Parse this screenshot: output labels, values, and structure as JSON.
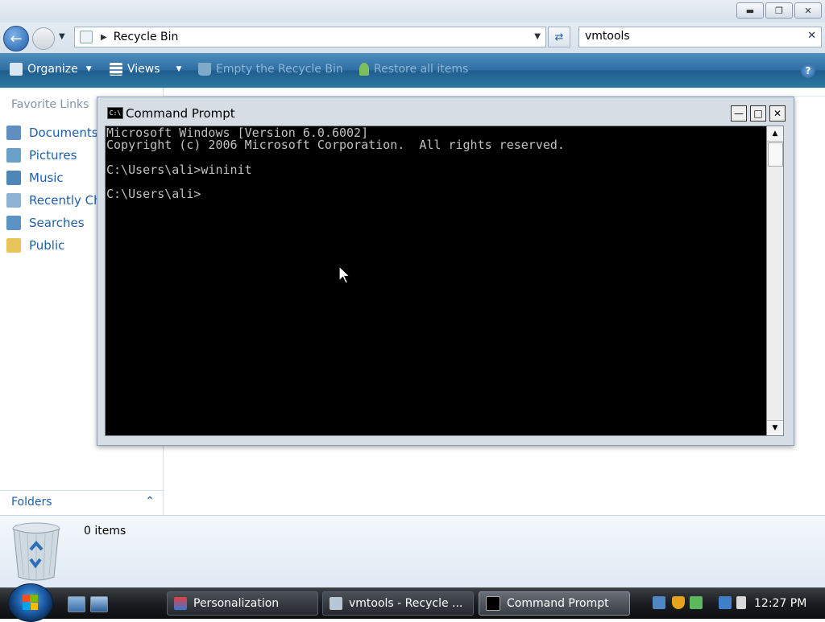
{
  "explorer": {
    "address": {
      "location": "Recycle Bin"
    },
    "search": {
      "value": "vmtools"
    },
    "toolbar": {
      "organize": "Organize",
      "views": "Views",
      "empty": "Empty the Recycle Bin",
      "restore": "Restore all items"
    },
    "nav": {
      "favorites_header": "Favorite Links",
      "links": [
        "Documents",
        "Pictures",
        "Music",
        "Recently Ch",
        "Searches",
        "Public"
      ],
      "folders": "Folders"
    },
    "details": {
      "count": "0 items"
    }
  },
  "cmd": {
    "title": "Command Prompt",
    "icon_label": "C:\\",
    "lines": [
      "Microsoft Windows [Version 6.0.6002]",
      "Copyright (c) 2006 Microsoft Corporation.  All rights reserved.",
      "",
      "C:\\Users\\ali>wininit",
      "",
      "C:\\Users\\ali>"
    ]
  },
  "taskbar": {
    "tasks": [
      "Personalization",
      "vmtools - Recycle ...",
      "Command Prompt"
    ],
    "clock": "12:27 PM"
  },
  "colors": {
    "toolbar_blue": "#2f6ea3",
    "link_blue": "#1e5fae",
    "console_bg": "#000000",
    "console_text": "#c0c0c0"
  },
  "icons": [
    "back-arrow-icon",
    "forward-arrow-icon",
    "recycle-bin-icon",
    "refresh-icon",
    "close-icon",
    "organize-icon",
    "views-icon",
    "empty-bin-icon",
    "restore-icon",
    "help-icon",
    "windows-flag-icon"
  ]
}
